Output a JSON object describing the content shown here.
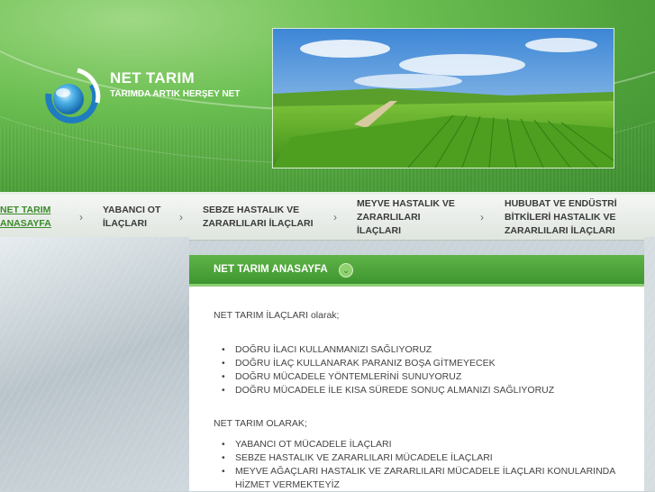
{
  "site": {
    "title": "NET TARIM",
    "subtitle": "TARIMDA ARTIK HERŞEY NET"
  },
  "nav": {
    "items": [
      {
        "line1": "NET TARIM",
        "line2": "ANASAYFA",
        "line3": ""
      },
      {
        "line1": "YABANCI OT",
        "line2": "İLAÇLARI",
        "line3": ""
      },
      {
        "line1": "SEBZE HASTALIK VE",
        "line2": "ZARARLILARI İLAÇLARI",
        "line3": ""
      },
      {
        "line1": "MEYVE HASTALIK VE",
        "line2": "ZARARLILARI",
        "line3": "İLAÇLARI"
      },
      {
        "line1": "HUBUBAT VE ENDÜSTRİ",
        "line2": "BİTKİLERİ HASTALIK VE",
        "line3": "ZARARLILARI İLAÇLARI"
      }
    ]
  },
  "content": {
    "heading": "NET TARIM ANASAYFA",
    "intro1": "NET TARIM İLAÇLARI olarak;",
    "list1": [
      "DOĞRU İLACI KULLANMANIZI SAĞLIYORUZ",
      "DOĞRU İLAÇ KULLANARAK PARANIZ BOŞA GİTMEYECEK",
      "DOĞRU MÜCADELE YÖNTEMLERİNİ SUNUYORUZ",
      "DOĞRU MÜCADELE İLE KISA SÜREDE SONUÇ ALMANIZI SAĞLIYORUZ"
    ],
    "intro2": "NET TARIM OLARAK;",
    "list2": [
      "YABANCI OT MÜCADELE İLAÇLARI",
      "SEBZE HASTALIK VE ZARARLILARI MÜCADELE İLAÇLARI",
      "MEYVE AĞAÇLARI HASTALIK VE ZARARLILARI MÜCADELE İLAÇLARI KONULARINDA",
      "HİZMET VERMEKTEYİZ"
    ]
  },
  "colors": {
    "brand_green": "#4da03a",
    "active_nav": "#3b8a2a"
  },
  "icons": {
    "logo": "globe-logo-icon",
    "nav_separator": "chevron-right-icon",
    "heading_toggle": "chevron-down-icon"
  }
}
